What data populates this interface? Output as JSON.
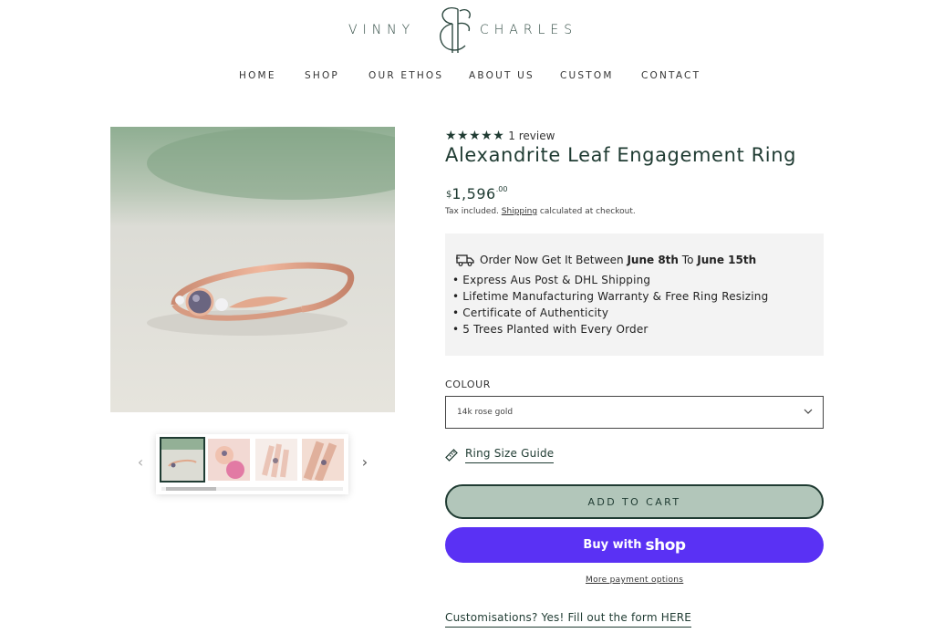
{
  "brand": {
    "left": "VINNY",
    "right": "CHARLES",
    "mark_color": "#1f3b32"
  },
  "nav": {
    "items": [
      "HOME",
      "SHOP",
      "OUR ETHOS",
      "ABOUT US",
      "CUSTOM",
      "CONTACT"
    ]
  },
  "gallery": {
    "prev_glyph": "‹",
    "next_glyph": "›",
    "thumb_count": 4,
    "active_thumb": 1
  },
  "product": {
    "stars": "★★★★★",
    "review_text": "1 review",
    "title": "Alexandrite Leaf Engagement Ring",
    "currency": "$",
    "price": "1,596",
    "cents": ".00",
    "tax_prefix": "Tax included.",
    "shipping_link": "Shipping",
    "tax_suffix": "calculated at checkout."
  },
  "info": {
    "head_prefix": "Order Now Get It Between",
    "date_start": "June 8th",
    "to": "To",
    "date_end": "June 15th",
    "items": [
      "Express Aus Post & DHL Shipping",
      "Lifetime Manufacturing Warranty & Free Ring Resizing",
      "Certificate of Authenticity",
      "5 Trees Planted with Every Order"
    ]
  },
  "colour": {
    "label": "COLOUR",
    "selected": "14k rose gold"
  },
  "size_guide": "Ring Size Guide",
  "buttons": {
    "add_to_cart": "ADD TO CART",
    "buy_with": "Buy with",
    "shop": "shop",
    "more_payment": "More payment options",
    "shop_color": "#5a31f4",
    "cart_color": "#b2c6ba"
  },
  "custom_link": "Customisations? Yes! Fill out the form HERE"
}
